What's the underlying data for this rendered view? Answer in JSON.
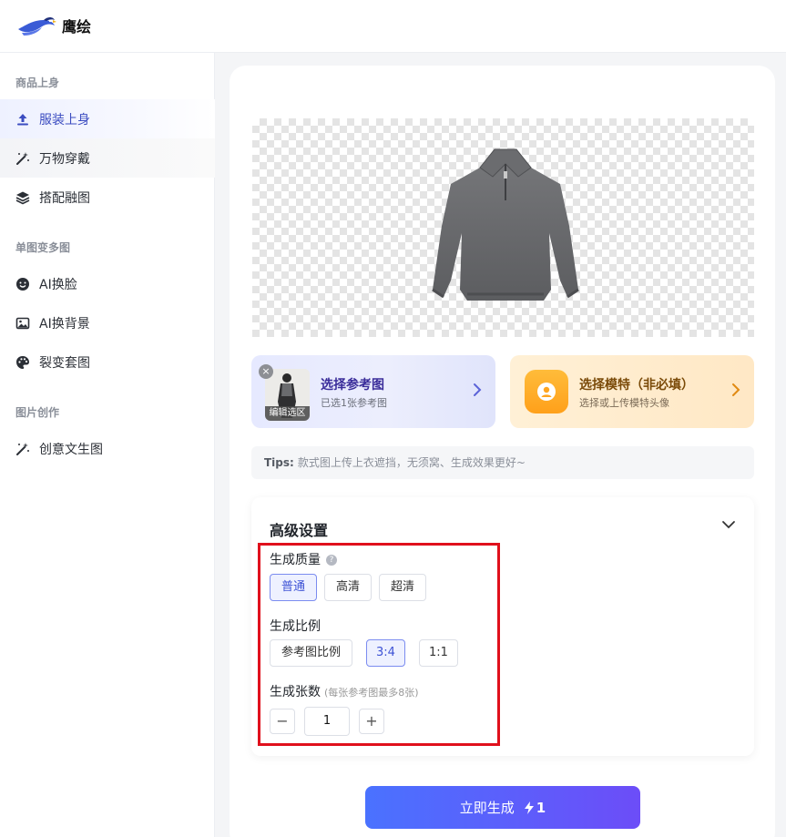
{
  "app": {
    "name": "鹰绘"
  },
  "sidebar": {
    "groups": [
      {
        "title": "商品上身",
        "items": [
          {
            "label": "服装上身",
            "icon": "upload-icon"
          },
          {
            "label": "万物穿戴",
            "icon": "magic-wand-icon"
          },
          {
            "label": "搭配融图",
            "icon": "layers-icon"
          }
        ]
      },
      {
        "title": "单图变多图",
        "items": [
          {
            "label": "AI换脸",
            "icon": "smile-icon"
          },
          {
            "label": "AI换背景",
            "icon": "image-icon"
          },
          {
            "label": "裂变套图",
            "icon": "palette-icon"
          }
        ]
      },
      {
        "title": "图片创作",
        "items": [
          {
            "label": "创意文生图",
            "icon": "magic-wand-icon"
          }
        ]
      }
    ]
  },
  "reference_card": {
    "title": "选择参考图",
    "subtitle": "已选1张参考图",
    "thumb_label": "编辑选区"
  },
  "model_card": {
    "title": "选择模特（非必填）",
    "subtitle": "选择或上传模特头像"
  },
  "tips": {
    "prefix": "Tips:",
    "text": "款式图上传上衣遮挡，无须窝、生成效果更好~"
  },
  "settings": {
    "title": "高级设置",
    "quality": {
      "label": "生成质量",
      "options": [
        "普通",
        "高清",
        "超清"
      ],
      "selected": "普通"
    },
    "ratio": {
      "label": "生成比例",
      "options": [
        "参考图比例",
        "3:4",
        "1:1"
      ],
      "selected": "3:4"
    },
    "count": {
      "label": "生成张数",
      "hint": "(每张参考图最多8张)",
      "value": "1",
      "minus": "−",
      "plus": "+"
    }
  },
  "generate": {
    "label": "立即生成",
    "cost": "1"
  },
  "colors": {
    "accent": "#4a72ff",
    "highlight_box": "#e0101c"
  }
}
